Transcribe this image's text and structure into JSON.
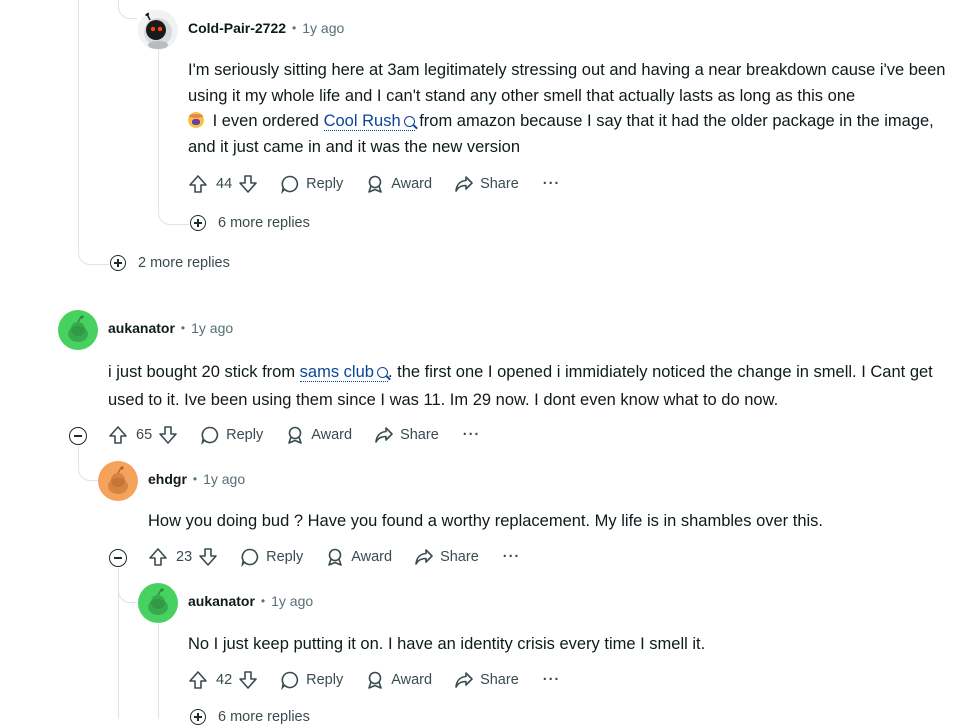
{
  "comments": [
    {
      "username": "Cold-Pair-2722",
      "time": "1y ago",
      "text_before_link": "I'm seriously sitting here at 3am legitimately stressing out and having a near breakdown cause i've been using it my whole life and I can't stand any other smell that actually lasts as long as this one",
      "emoji": "crying-face-emoji",
      "text_mid": " I even ordered ",
      "link": "Cool Rush",
      "text_after_link": " from amazon because I say that it had the older package in the image, and it just came in and it was the new version",
      "votes": "44",
      "more_replies": "6 more replies"
    },
    {
      "parent_more_replies": "2 more replies"
    },
    {
      "username": "aukanator",
      "time": "1y ago",
      "text_before_link": "i just bought 20 stick from ",
      "link": "sams club",
      "text_after_link": ". the first one I opened i immidiately noticed the change in smell. I Cant get used to it. Ive been using them since I was 11. Im 29 now. I dont even know what to do now.",
      "votes": "65"
    },
    {
      "username": "ehdgr",
      "time": "1y ago",
      "text": "How you doing bud ? Have you found a worthy replacement. My life is in shambles over this.",
      "votes": "23"
    },
    {
      "username": "aukanator",
      "time": "1y ago",
      "text": "No I just keep putting it on. I have an identity crisis every time I smell it.",
      "votes": "42",
      "more_replies": "6 more replies"
    }
  ],
  "labels": {
    "reply": "Reply",
    "award": "Award",
    "share": "Share",
    "more": "···",
    "dot": "•"
  },
  "colors": {
    "link": "#0a449b",
    "avatar_green": "#46d160",
    "avatar_orange": "#f5a25d",
    "thread_line": "#dfe3e6"
  }
}
